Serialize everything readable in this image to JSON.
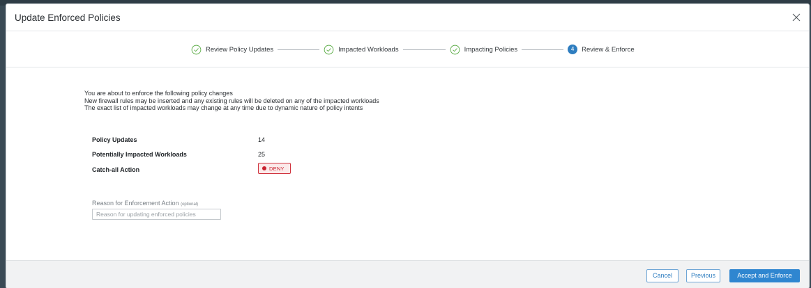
{
  "modal": {
    "title": "Update Enforced Policies"
  },
  "stepper": {
    "steps": [
      {
        "label": "Review Policy Updates",
        "state": "complete"
      },
      {
        "label": "Impacted Workloads",
        "state": "complete"
      },
      {
        "label": "Impacting Policies",
        "state": "complete"
      },
      {
        "label": "Review & Enforce",
        "state": "active",
        "number": "4"
      }
    ]
  },
  "description": [
    "You are about to enforce the following policy changes",
    "New firewall rules may be inserted and any existing rules will be deleted on any of the impacted workloads",
    "The exact list of impacted workloads may change at any time due to dynamic nature of policy intents"
  ],
  "summary": {
    "policy_updates_label": "Policy Updates",
    "policy_updates_value": "14",
    "impacted_workloads_label": "Potentially Impacted Workloads",
    "impacted_workloads_value": "25",
    "catch_all_label": "Catch-all Action",
    "catch_all_value": "DENY"
  },
  "reason": {
    "label": "Reason for Enforcement Action",
    "optional": "(optional)",
    "placeholder": "Reason for updating enforced policies",
    "value": ""
  },
  "footer": {
    "cancel": "Cancel",
    "previous": "Previous",
    "accept": "Accept and Enforce"
  },
  "colors": {
    "accent": "#2f7ec0",
    "deny": "#c8222f",
    "complete_check": "#5fae4a"
  },
  "icons": {
    "close": "close-icon",
    "complete": "check-circle-icon"
  }
}
